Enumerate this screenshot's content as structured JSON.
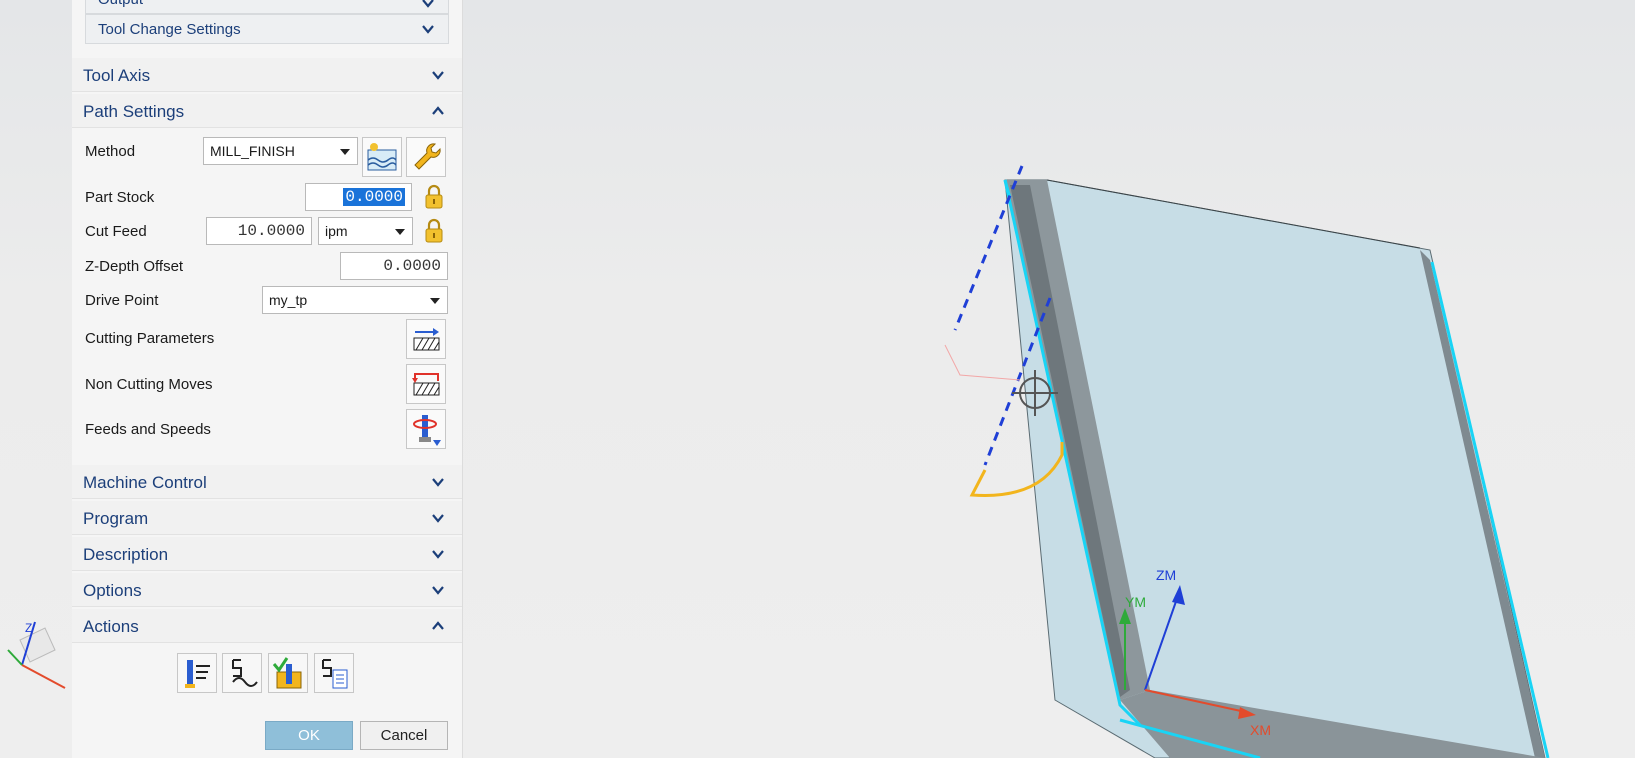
{
  "dialog": {
    "output_label": "Output",
    "tool_change_label": "Tool Change Settings",
    "sections": {
      "tool_axis": "Tool Axis",
      "path_settings": "Path Settings",
      "machine_control": "Machine Control",
      "program": "Program",
      "description": "Description",
      "options": "Options",
      "actions": "Actions"
    },
    "path": {
      "method_label": "Method",
      "method_value": "MILL_FINISH",
      "part_stock_label": "Part Stock",
      "part_stock_value": "0.0000",
      "cut_feed_label": "Cut Feed",
      "cut_feed_value": "10.0000",
      "cut_feed_unit": "ipm",
      "z_depth_label": "Z-Depth Offset",
      "z_depth_value": "0.0000",
      "drive_point_label": "Drive Point",
      "drive_point_value": "my_tp",
      "cutting_params_label": "Cutting Parameters",
      "non_cutting_label": "Non Cutting Moves",
      "feeds_speeds_label": "Feeds and Speeds"
    },
    "ok_label": "OK",
    "cancel_label": "Cancel"
  },
  "viewport": {
    "axis_zm": "ZM",
    "axis_ym": "YM",
    "axis_xm": "XM",
    "triad_z": "Z"
  },
  "colors": {
    "section_text": "#1c3f7a",
    "selection": "#1a73d9",
    "ok_button": "#8fbfd9",
    "part_face": "#c7dde6",
    "edge_highlight": "#19d4f5",
    "tool_axis_dashes": "#1f3fd6",
    "arc": "#f2b51d"
  },
  "icons": [
    "chevron-down-icon",
    "chevron-up-icon",
    "method-icon",
    "wrench-icon",
    "lock-icon",
    "cutting-parameters-icon",
    "non-cutting-moves-icon",
    "feeds-speeds-icon",
    "generate-icon",
    "replay-icon",
    "verify-icon",
    "list-icon"
  ]
}
